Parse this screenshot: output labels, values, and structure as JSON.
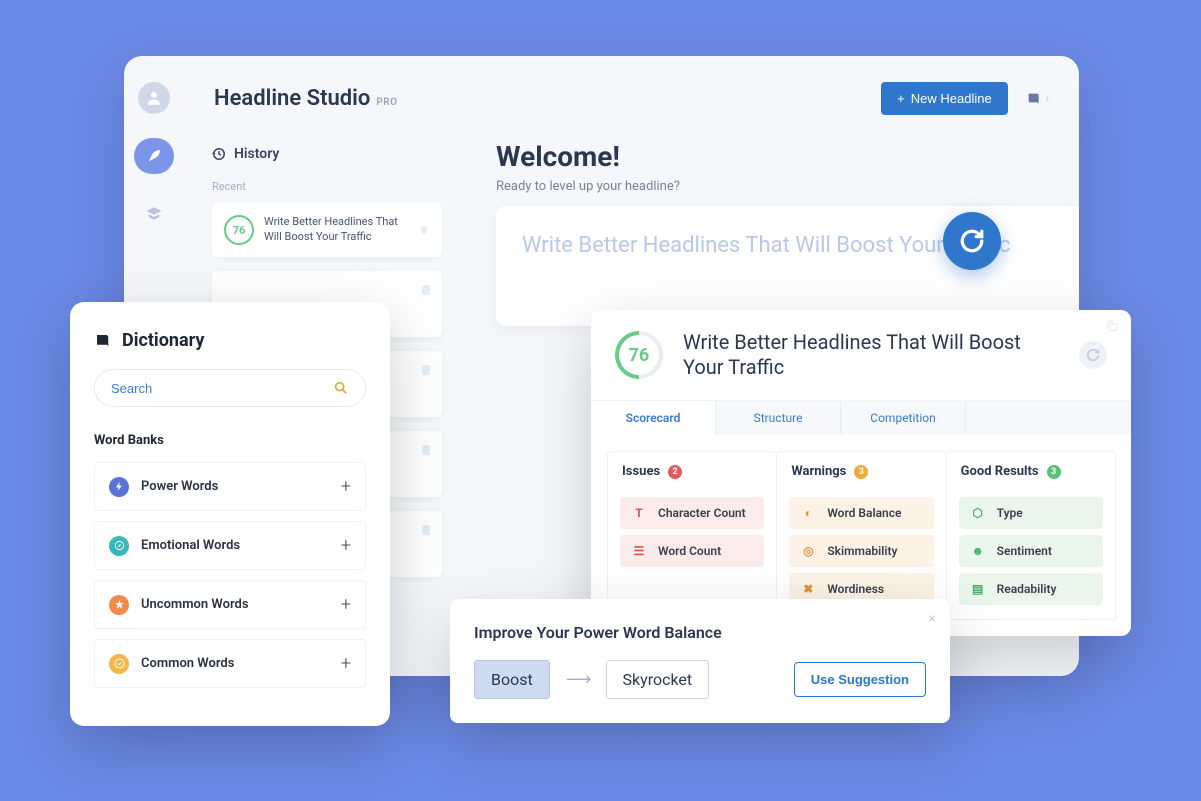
{
  "header": {
    "app_title": "Headline Studio",
    "tier": "PRO",
    "new_btn": "New Headline"
  },
  "history": {
    "title": "History",
    "recent_label": "Recent",
    "score": "76",
    "recent_headline": "Write Better Headlines That Will Boost Your Traffic"
  },
  "welcome": {
    "title": "Welcome!",
    "subtitle": "Ready to level up your headline?"
  },
  "headline_input": "Write Better Headlines That Will Boost Your Traffic",
  "dictionary": {
    "title": "Dictionary",
    "search_placeholder": "Search",
    "wordbanks_title": "Word Banks",
    "banks": [
      {
        "label": "Power Words",
        "color": "#5b72d8"
      },
      {
        "label": "Emotional Words",
        "color": "#38b7bc"
      },
      {
        "label": "Uncommon Words",
        "color": "#f08b4b"
      },
      {
        "label": "Common Words",
        "color": "#f3b84b"
      }
    ]
  },
  "scorecard": {
    "score": "76",
    "headline": "Write Better Headlines That Will Boost Your Traffic",
    "tabs": [
      {
        "label": "Scorecard",
        "active": true
      },
      {
        "label": "Structure",
        "active": false
      },
      {
        "label": "Competition",
        "active": false
      }
    ],
    "columns": {
      "issues": {
        "title": "Issues",
        "count": "2",
        "items": [
          "Character Count",
          "Word Count"
        ]
      },
      "warnings": {
        "title": "Warnings",
        "count": "3",
        "items": [
          "Word Balance",
          "Skimmability",
          "Wordiness"
        ]
      },
      "good": {
        "title": "Good Results",
        "count": "3",
        "items": [
          "Type",
          "Sentiment",
          "Readability"
        ]
      }
    }
  },
  "suggestion": {
    "title": "Improve Your Power Word Balance",
    "from": "Boost",
    "to": "Skyrocket",
    "cta": "Use Suggestion"
  }
}
